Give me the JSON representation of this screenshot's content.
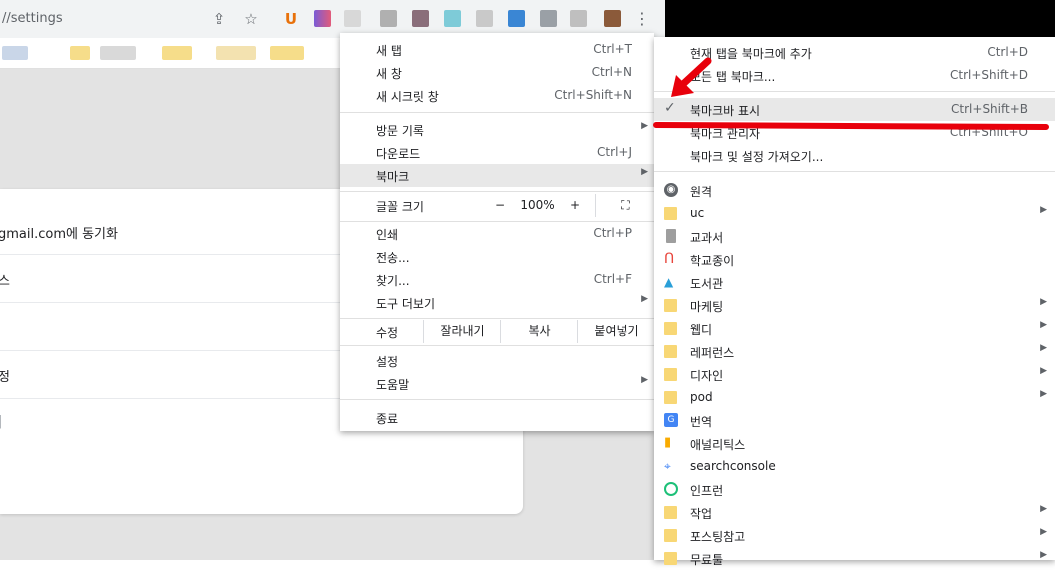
{
  "browser": {
    "url": "//settings",
    "colors": {
      "toolbar": "#f1f3f4",
      "accent": "#e8000b"
    }
  },
  "settings": {
    "rows": [
      {
        "label": "gmail.com에 동기화"
      },
      {
        "label": "스"
      },
      {
        "label": ""
      },
      {
        "label": "정"
      },
      {
        "label": "|"
      }
    ]
  },
  "main_menu": {
    "items": [
      {
        "label": "새 탭",
        "shortcut": "Ctrl+T"
      },
      {
        "label": "새 창",
        "shortcut": "Ctrl+N"
      },
      {
        "label": "새 시크릿 창",
        "shortcut": "Ctrl+Shift+N"
      },
      {
        "label": "방문 기록",
        "shortcut": ""
      },
      {
        "label": "다운로드",
        "shortcut": "Ctrl+J"
      },
      {
        "label": "북마크",
        "shortcut": ""
      }
    ],
    "zoom": {
      "label": "글꼴 크기",
      "minus": "−",
      "value": "100%",
      "plus": "+",
      "fullscreen_icon": "fullscreen-icon"
    },
    "items2": [
      {
        "label": "인쇄",
        "shortcut": "Ctrl+P"
      },
      {
        "label": "전송...",
        "shortcut": ""
      },
      {
        "label": "찾기...",
        "shortcut": "Ctrl+F"
      },
      {
        "label": "도구 더보기",
        "shortcut": ""
      }
    ],
    "edit": {
      "label": "수정",
      "cut": "잘라내기",
      "copy": "복사",
      "paste": "붙여넣기"
    },
    "items3": [
      {
        "label": "설정"
      },
      {
        "label": "도움말"
      }
    ],
    "exit": "종료"
  },
  "bookmark_menu": {
    "actions": [
      {
        "label": "현재 탭을 북마크에 추가",
        "shortcut": "Ctrl+D"
      },
      {
        "label": "모든 탭 북마크...",
        "shortcut": "Ctrl+Shift+D"
      },
      {
        "label": "북마크바 표시",
        "shortcut": "Ctrl+Shift+B"
      },
      {
        "label": "북마크 관리자",
        "shortcut": "Ctrl+Shift+O"
      },
      {
        "label": "북마크 및 설정 가져오기...",
        "shortcut": ""
      }
    ],
    "bookmarks": [
      {
        "label": "원격",
        "icon": "globe-icon"
      },
      {
        "label": "uc",
        "icon": "folder-icon"
      },
      {
        "label": "교과서",
        "icon": "book-icon"
      },
      {
        "label": "학교종이",
        "icon": "school-icon"
      },
      {
        "label": "도서관",
        "icon": "library-icon"
      },
      {
        "label": "마케팅",
        "icon": "folder-icon"
      },
      {
        "label": "웹디",
        "icon": "folder-icon"
      },
      {
        "label": "레퍼런스",
        "icon": "folder-icon"
      },
      {
        "label": "디자인",
        "icon": "folder-icon"
      },
      {
        "label": "pod",
        "icon": "folder-icon"
      },
      {
        "label": "번역",
        "icon": "translate-icon"
      },
      {
        "label": "애널리틱스",
        "icon": "analytics-icon"
      },
      {
        "label": "searchconsole",
        "icon": "searchconsole-icon"
      },
      {
        "label": "인프런",
        "icon": "inflearn-icon"
      },
      {
        "label": "작업",
        "icon": "folder-icon"
      },
      {
        "label": "포스팅참고",
        "icon": "folder-icon"
      },
      {
        "label": "무료툴",
        "icon": "folder-icon"
      }
    ]
  }
}
